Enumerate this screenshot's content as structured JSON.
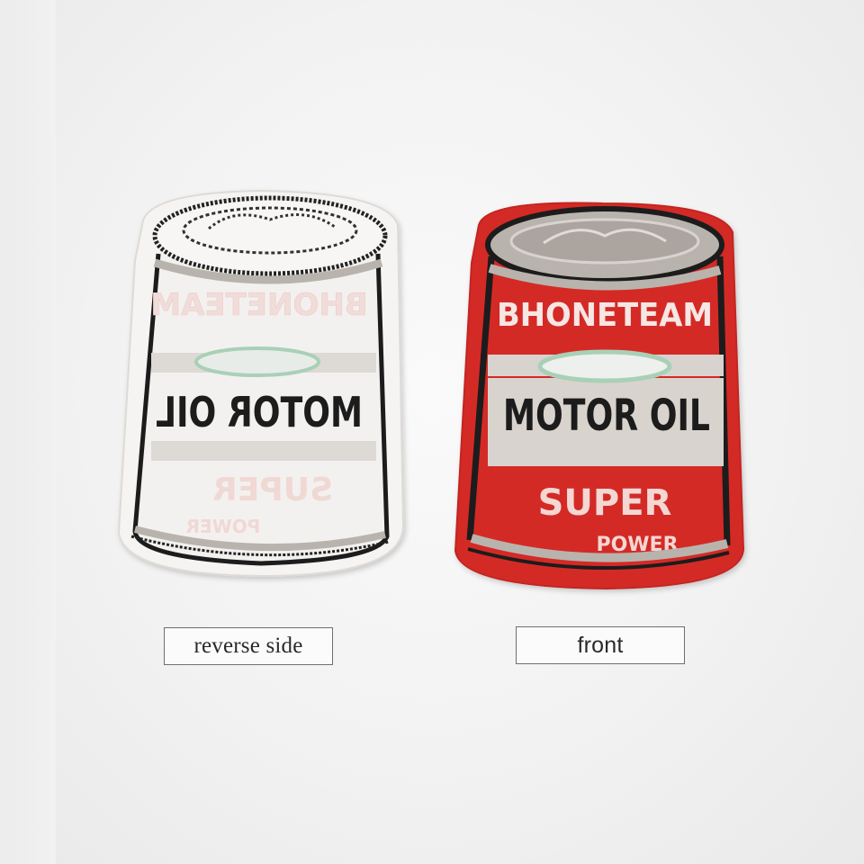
{
  "labels": {
    "reverse": "reverse side",
    "front": "front"
  },
  "patches": {
    "reverse": {
      "brand": "BHONETEAM",
      "title": "MOTOR OIL",
      "line1": "SUPER",
      "line2": "POWER"
    },
    "front": {
      "brand": "BHONETEAM",
      "title": "MOTOR OIL",
      "line1": "SUPER",
      "line2": "POWER"
    }
  },
  "colors": {
    "background": "#f1f1f1",
    "front_patch": "#d52a26",
    "reverse_patch": "#f4f1ee",
    "stitch_dark": "#1b1b1b",
    "stitch_silver": "#b9b3ad",
    "stitch_pink": "#f3d7d3",
    "emblem_green": "#a9d0b7"
  }
}
